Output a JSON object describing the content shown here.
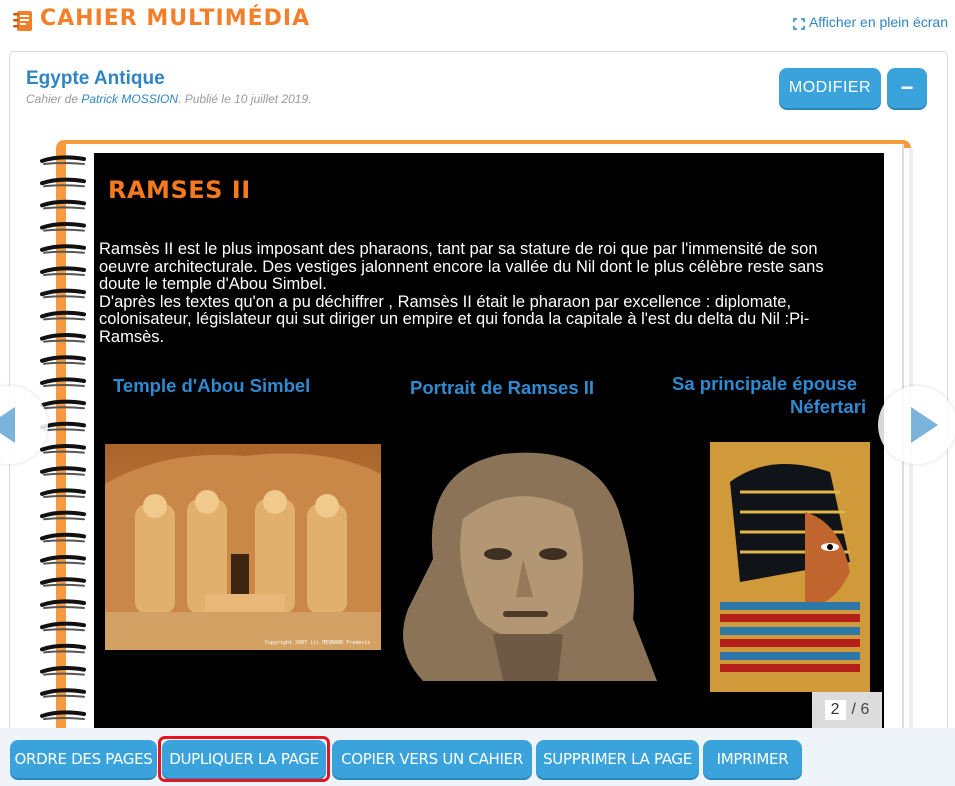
{
  "app": {
    "title": "CAHIER MULTIMÉDIA",
    "fullscreen_label": "Afficher en plein écran"
  },
  "notebook": {
    "title": "Egypte Antique",
    "meta_prefix": "Cahier de ",
    "author": "Patrick MOSSION",
    "meta_suffix": ". Publié le 10 juillet 2019.",
    "modify_label": "MODIFIER",
    "collapse_label": "−"
  },
  "page": {
    "heading": "RAMSES II",
    "paragraph1": "Ramsès II est le plus imposant des pharaons, tant par sa stature de roi que par l'immensité de son oeuvre architecturale. Des vestiges jalonnent encore la vallée du Nil dont le plus célèbre reste sans doute le temple d'Abou Simbel.",
    "paragraph2": "D'après les textes qu'on a pu déchiffrer , Ramsès II était le pharaon par excellence : diplomate, colonisateur, législateur qui sut diriger un empire et qui fonda la capitale à l'est du delta du Nil :Pi-Ramsès.",
    "captions": [
      "Temple d'Abou Simbel",
      "Portrait de Ramses II",
      "Sa principale épouse",
      "Néfertari"
    ],
    "image_credit": "Copyright 2007 (c) MESNARD Frederic",
    "current_page": "2",
    "total_pages": "/ 6"
  },
  "toolbar": {
    "buttons": [
      "ORDRE DES PAGES",
      "DUPLIQUER LA PAGE",
      "COPIER VERS UN CAHIER",
      "SUPPRIMER LA PAGE",
      "IMPRIMER"
    ]
  },
  "colors": {
    "accent_orange": "#f47f2a",
    "brand_blue": "#3aa3dc",
    "highlight_red": "#e8141d"
  }
}
